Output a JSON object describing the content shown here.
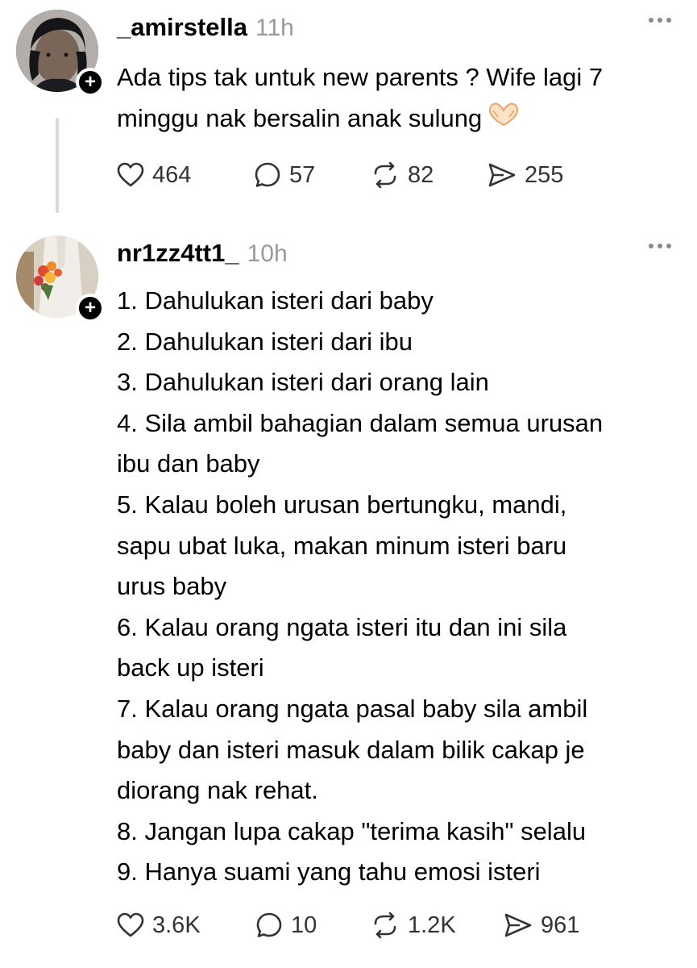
{
  "posts": [
    {
      "username": "_amirstella",
      "time": "11h",
      "lines": [
        "Ada tips tak untuk new parents ? Wife lagi 7",
        "minggu nak bersalin anak sulung"
      ],
      "emoji": "heart-hands-emoji",
      "stats": {
        "likes": "464",
        "replies": "57",
        "reposts": "82",
        "shares": "255"
      }
    },
    {
      "username": "nr1zz4tt1_",
      "time": "10h",
      "lines": [
        "1. Dahulukan isteri dari baby",
        "2. Dahulukan isteri dari ibu",
        "3. Dahulukan isteri dari orang lain",
        "4. Sila ambil bahagian dalam semua urusan",
        "ibu dan baby",
        "5. Kalau boleh urusan bertungku, mandi,",
        "sapu ubat luka, makan minum isteri baru",
        "urus baby",
        "6. Kalau orang ngata isteri itu dan ini sila",
        "back up isteri",
        "7. Kalau orang ngata pasal baby sila ambil",
        "baby dan isteri masuk dalam bilik cakap je",
        "diorang nak rehat.",
        "8. Jangan lupa cakap \"terima kasih\" selalu",
        "9. Hanya suami yang tahu emosi isteri"
      ],
      "stats": {
        "likes": "3.6K",
        "replies": "10",
        "reposts": "1.2K",
        "shares": "961"
      }
    }
  ],
  "follow_symbol": "+",
  "icons": {
    "like": "heart-icon",
    "reply": "speech-bubble-icon",
    "repost": "repost-arrows-icon",
    "share": "send-icon",
    "more": "more-dots-icon"
  },
  "colors": {
    "text": "#000000",
    "muted": "#999999",
    "icon": "#333333",
    "thread_line": "#d9d9d9"
  }
}
